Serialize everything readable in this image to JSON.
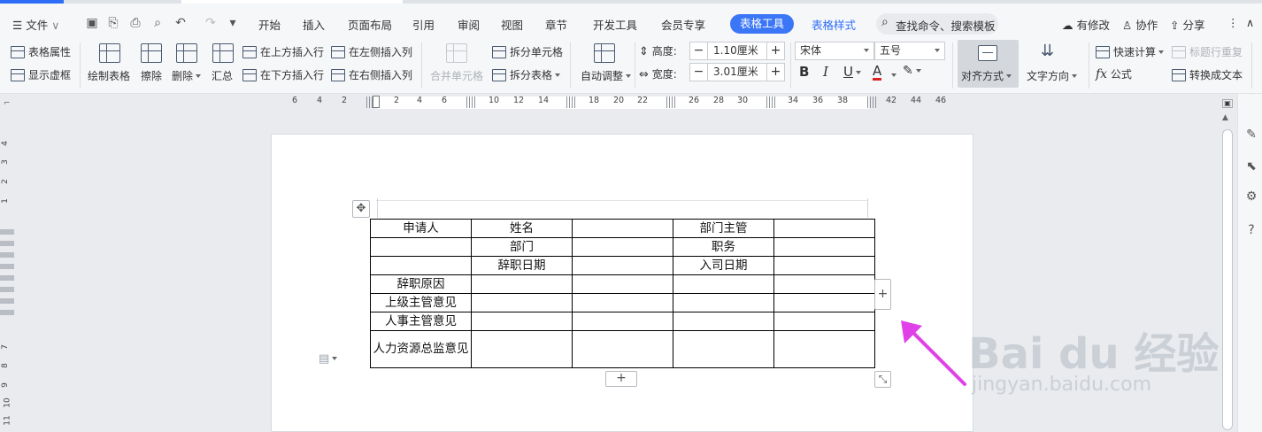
{
  "menubar": {
    "file": "文件",
    "tabs": [
      "开始",
      "插入",
      "页面布局",
      "引用",
      "审阅",
      "视图",
      "章节",
      "开发工具",
      "会员专享"
    ],
    "active_tab": "表格工具",
    "extra_tab": "表格样式",
    "search_placeholder": "查找命令、搜索模板",
    "modified": "有修改",
    "collaborate": "协作",
    "share": "分享"
  },
  "ribbon": {
    "table_props": "表格属性",
    "show_gridlines": "显示虚框",
    "draw_table": "绘制表格",
    "erase": "擦除",
    "delete": "删除",
    "summary": "汇总",
    "insert_above": "在上方插入行",
    "insert_below": "在下方插入行",
    "insert_left": "在左侧插入列",
    "insert_right": "在右侧插入列",
    "merge_cells": "合并单元格",
    "split_cells": "拆分单元格",
    "split_table": "拆分表格",
    "auto_fit": "自动调整",
    "height_label": "高度:",
    "height_value": "1.10厘米",
    "width_label": "宽度:",
    "width_value": "3.01厘米",
    "font_name": "宋体",
    "font_size": "五号",
    "align": "对齐方式",
    "text_dir": "文字方向",
    "quick_calc": "快速计算",
    "repeat_header": "标题行重复",
    "formula": "公式",
    "to_text": "转换成文本"
  },
  "ruler": {
    "h_numbers": [
      "6",
      "4",
      "2",
      "2",
      "4",
      "6",
      "10",
      "12",
      "14",
      "18",
      "20",
      "22",
      "26",
      "28",
      "30",
      "34",
      "36",
      "38",
      "42",
      "44",
      "46"
    ],
    "v_numbers": [
      "4",
      "3",
      "2",
      "1",
      "7",
      "8",
      "9",
      "10",
      "11"
    ]
  },
  "table": {
    "rows": [
      [
        "申请人",
        "姓名",
        "",
        "部门主管",
        ""
      ],
      [
        "",
        "部门",
        "",
        "职务",
        ""
      ],
      [
        "",
        "辞职日期",
        "",
        "入司日期",
        ""
      ],
      [
        "辞职原因",
        "",
        "",
        "",
        ""
      ],
      [
        "上级主管意见",
        "",
        "",
        "",
        ""
      ],
      [
        "人事主管意见",
        "",
        "",
        "",
        ""
      ],
      [
        "人力资源总监意见",
        "",
        "",
        "",
        ""
      ]
    ]
  },
  "watermark": {
    "brand": "Bai du 经验",
    "url": "jingyan.baidu.com"
  },
  "colors": {
    "accent": "#3b76f6",
    "arrow": "#e040e8"
  }
}
